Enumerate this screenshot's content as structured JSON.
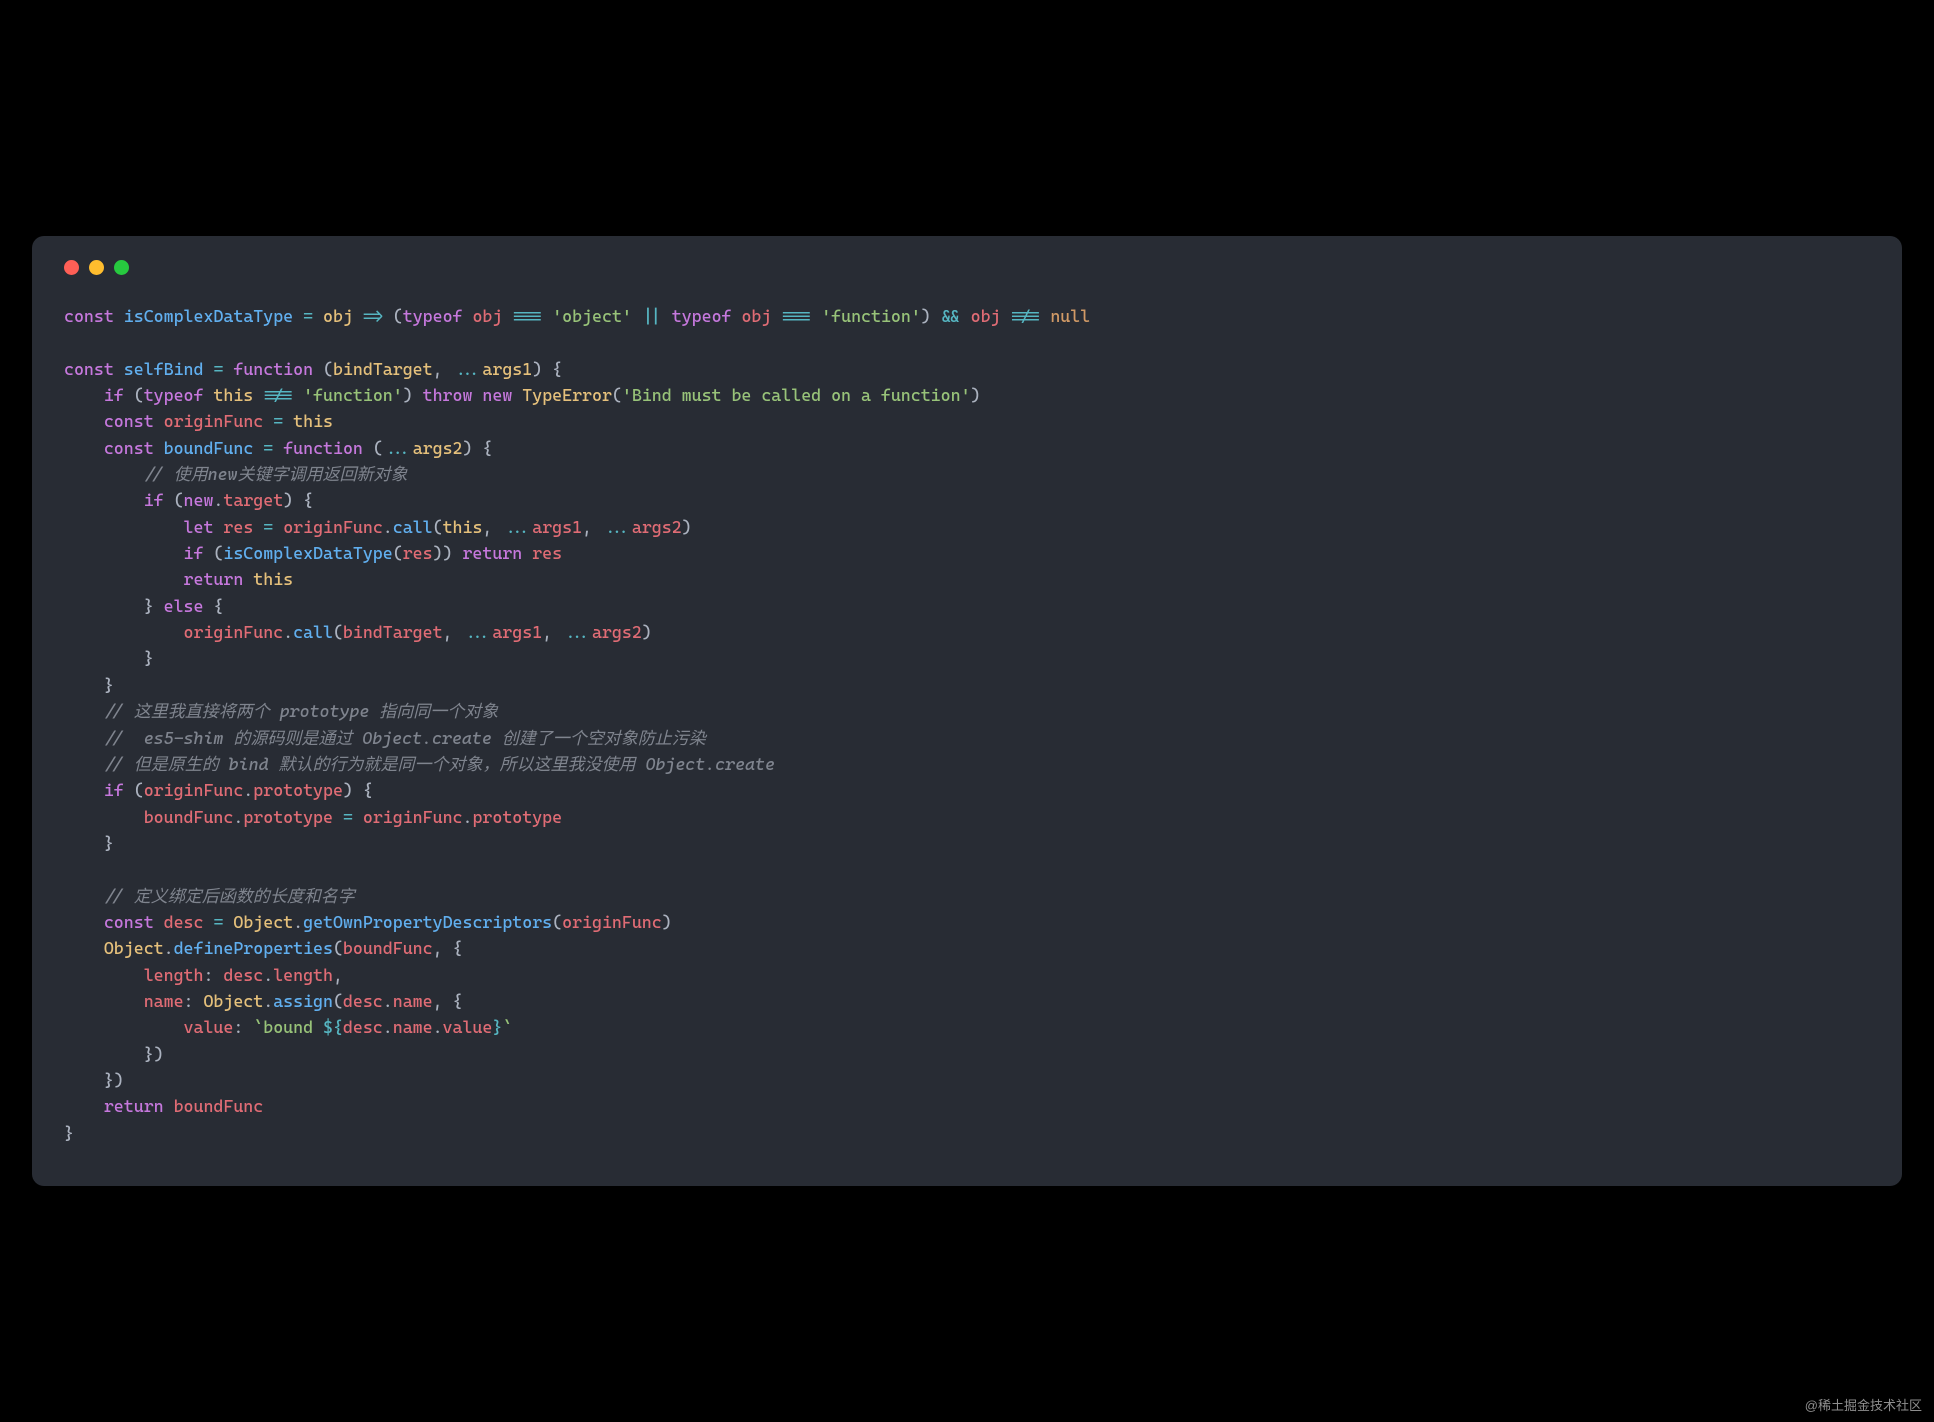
{
  "watermark": "@稀土掘金技术社区",
  "code": {
    "lines": [
      {
        "segments": [
          {
            "cls": "kw",
            "t": "const"
          },
          {
            "cls": "punc",
            "t": " "
          },
          {
            "cls": "fn",
            "t": "isComplexDataType"
          },
          {
            "cls": "punc",
            "t": " "
          },
          {
            "cls": "op",
            "t": "="
          },
          {
            "cls": "punc",
            "t": " "
          },
          {
            "cls": "param",
            "t": "obj"
          },
          {
            "cls": "punc",
            "t": " "
          },
          {
            "cls": "op",
            "t": "=>"
          },
          {
            "cls": "punc",
            "t": " ("
          },
          {
            "cls": "kw",
            "t": "typeof"
          },
          {
            "cls": "punc",
            "t": " "
          },
          {
            "cls": "var",
            "t": "obj"
          },
          {
            "cls": "punc",
            "t": " "
          },
          {
            "cls": "op",
            "t": "==="
          },
          {
            "cls": "punc",
            "t": " "
          },
          {
            "cls": "str",
            "t": "'object'"
          },
          {
            "cls": "punc",
            "t": " "
          },
          {
            "cls": "op",
            "t": "||"
          },
          {
            "cls": "punc",
            "t": " "
          },
          {
            "cls": "kw",
            "t": "typeof"
          },
          {
            "cls": "punc",
            "t": " "
          },
          {
            "cls": "var",
            "t": "obj"
          },
          {
            "cls": "punc",
            "t": " "
          },
          {
            "cls": "op",
            "t": "==="
          },
          {
            "cls": "punc",
            "t": " "
          },
          {
            "cls": "str",
            "t": "'function'"
          },
          {
            "cls": "punc",
            "t": ") "
          },
          {
            "cls": "op",
            "t": "&&"
          },
          {
            "cls": "punc",
            "t": " "
          },
          {
            "cls": "var",
            "t": "obj"
          },
          {
            "cls": "punc",
            "t": " "
          },
          {
            "cls": "op",
            "t": "!=="
          },
          {
            "cls": "punc",
            "t": " "
          },
          {
            "cls": "num",
            "t": "null"
          }
        ]
      },
      {
        "segments": []
      },
      {
        "segments": [
          {
            "cls": "kw",
            "t": "const"
          },
          {
            "cls": "punc",
            "t": " "
          },
          {
            "cls": "fn",
            "t": "selfBind"
          },
          {
            "cls": "punc",
            "t": " "
          },
          {
            "cls": "op",
            "t": "="
          },
          {
            "cls": "punc",
            "t": " "
          },
          {
            "cls": "kw",
            "t": "function"
          },
          {
            "cls": "punc",
            "t": " ("
          },
          {
            "cls": "param",
            "t": "bindTarget"
          },
          {
            "cls": "punc",
            "t": ", "
          },
          {
            "cls": "op",
            "t": "..."
          },
          {
            "cls": "param",
            "t": "args1"
          },
          {
            "cls": "punc",
            "t": ") {"
          }
        ]
      },
      {
        "segments": [
          {
            "cls": "punc",
            "t": "    "
          },
          {
            "cls": "kw",
            "t": "if"
          },
          {
            "cls": "punc",
            "t": " ("
          },
          {
            "cls": "kw",
            "t": "typeof"
          },
          {
            "cls": "punc",
            "t": " "
          },
          {
            "cls": "this",
            "t": "this"
          },
          {
            "cls": "punc",
            "t": " "
          },
          {
            "cls": "op",
            "t": "!=="
          },
          {
            "cls": "punc",
            "t": " "
          },
          {
            "cls": "str",
            "t": "'function'"
          },
          {
            "cls": "punc",
            "t": ") "
          },
          {
            "cls": "kw",
            "t": "throw"
          },
          {
            "cls": "punc",
            "t": " "
          },
          {
            "cls": "kw",
            "t": "new"
          },
          {
            "cls": "punc",
            "t": " "
          },
          {
            "cls": "builtin",
            "t": "TypeError"
          },
          {
            "cls": "punc",
            "t": "("
          },
          {
            "cls": "str",
            "t": "'Bind must be called on a function'"
          },
          {
            "cls": "punc",
            "t": ")"
          }
        ]
      },
      {
        "segments": [
          {
            "cls": "punc",
            "t": "    "
          },
          {
            "cls": "kw",
            "t": "const"
          },
          {
            "cls": "punc",
            "t": " "
          },
          {
            "cls": "var",
            "t": "originFunc"
          },
          {
            "cls": "punc",
            "t": " "
          },
          {
            "cls": "op",
            "t": "="
          },
          {
            "cls": "punc",
            "t": " "
          },
          {
            "cls": "this",
            "t": "this"
          }
        ]
      },
      {
        "segments": [
          {
            "cls": "punc",
            "t": "    "
          },
          {
            "cls": "kw",
            "t": "const"
          },
          {
            "cls": "punc",
            "t": " "
          },
          {
            "cls": "fn",
            "t": "boundFunc"
          },
          {
            "cls": "punc",
            "t": " "
          },
          {
            "cls": "op",
            "t": "="
          },
          {
            "cls": "punc",
            "t": " "
          },
          {
            "cls": "kw",
            "t": "function"
          },
          {
            "cls": "punc",
            "t": " ("
          },
          {
            "cls": "op",
            "t": "..."
          },
          {
            "cls": "param",
            "t": "args2"
          },
          {
            "cls": "punc",
            "t": ") {"
          }
        ]
      },
      {
        "segments": [
          {
            "cls": "punc",
            "t": "        "
          },
          {
            "cls": "com",
            "t": "// 使用new关键字调用返回新对象"
          }
        ]
      },
      {
        "segments": [
          {
            "cls": "punc",
            "t": "        "
          },
          {
            "cls": "kw",
            "t": "if"
          },
          {
            "cls": "punc",
            "t": " ("
          },
          {
            "cls": "kw",
            "t": "new"
          },
          {
            "cls": "punc",
            "t": "."
          },
          {
            "cls": "prop",
            "t": "target"
          },
          {
            "cls": "punc",
            "t": ") {"
          }
        ]
      },
      {
        "segments": [
          {
            "cls": "punc",
            "t": "            "
          },
          {
            "cls": "kw",
            "t": "let"
          },
          {
            "cls": "punc",
            "t": " "
          },
          {
            "cls": "var",
            "t": "res"
          },
          {
            "cls": "punc",
            "t": " "
          },
          {
            "cls": "op",
            "t": "="
          },
          {
            "cls": "punc",
            "t": " "
          },
          {
            "cls": "var",
            "t": "originFunc"
          },
          {
            "cls": "punc",
            "t": "."
          },
          {
            "cls": "fn",
            "t": "call"
          },
          {
            "cls": "punc",
            "t": "("
          },
          {
            "cls": "this",
            "t": "this"
          },
          {
            "cls": "punc",
            "t": ", "
          },
          {
            "cls": "op",
            "t": "..."
          },
          {
            "cls": "var",
            "t": "args1"
          },
          {
            "cls": "punc",
            "t": ", "
          },
          {
            "cls": "op",
            "t": "..."
          },
          {
            "cls": "var",
            "t": "args2"
          },
          {
            "cls": "punc",
            "t": ")"
          }
        ]
      },
      {
        "segments": [
          {
            "cls": "punc",
            "t": "            "
          },
          {
            "cls": "kw",
            "t": "if"
          },
          {
            "cls": "punc",
            "t": " ("
          },
          {
            "cls": "fn",
            "t": "isComplexDataType"
          },
          {
            "cls": "punc",
            "t": "("
          },
          {
            "cls": "var",
            "t": "res"
          },
          {
            "cls": "punc",
            "t": ")) "
          },
          {
            "cls": "kw",
            "t": "return"
          },
          {
            "cls": "punc",
            "t": " "
          },
          {
            "cls": "var",
            "t": "res"
          }
        ]
      },
      {
        "segments": [
          {
            "cls": "punc",
            "t": "            "
          },
          {
            "cls": "kw",
            "t": "return"
          },
          {
            "cls": "punc",
            "t": " "
          },
          {
            "cls": "this",
            "t": "this"
          }
        ]
      },
      {
        "segments": [
          {
            "cls": "punc",
            "t": "        } "
          },
          {
            "cls": "kw",
            "t": "else"
          },
          {
            "cls": "punc",
            "t": " {"
          }
        ]
      },
      {
        "segments": [
          {
            "cls": "punc",
            "t": "            "
          },
          {
            "cls": "var",
            "t": "originFunc"
          },
          {
            "cls": "punc",
            "t": "."
          },
          {
            "cls": "fn",
            "t": "call"
          },
          {
            "cls": "punc",
            "t": "("
          },
          {
            "cls": "var",
            "t": "bindTarget"
          },
          {
            "cls": "punc",
            "t": ", "
          },
          {
            "cls": "op",
            "t": "..."
          },
          {
            "cls": "var",
            "t": "args1"
          },
          {
            "cls": "punc",
            "t": ", "
          },
          {
            "cls": "op",
            "t": "..."
          },
          {
            "cls": "var",
            "t": "args2"
          },
          {
            "cls": "punc",
            "t": ")"
          }
        ]
      },
      {
        "segments": [
          {
            "cls": "punc",
            "t": "        }"
          }
        ]
      },
      {
        "segments": [
          {
            "cls": "punc",
            "t": "    }"
          }
        ]
      },
      {
        "segments": [
          {
            "cls": "punc",
            "t": "    "
          },
          {
            "cls": "com",
            "t": "// 这里我直接将两个 prototype 指向同一个对象"
          }
        ]
      },
      {
        "segments": [
          {
            "cls": "punc",
            "t": "    "
          },
          {
            "cls": "com",
            "t": "//  es5-shim 的源码则是通过 Object.create 创建了一个空对象防止污染"
          }
        ]
      },
      {
        "segments": [
          {
            "cls": "punc",
            "t": "    "
          },
          {
            "cls": "com",
            "t": "// 但是原生的 bind 默认的行为就是同一个对象，所以这里我没使用 Object.create"
          }
        ]
      },
      {
        "segments": [
          {
            "cls": "punc",
            "t": "    "
          },
          {
            "cls": "kw",
            "t": "if"
          },
          {
            "cls": "punc",
            "t": " ("
          },
          {
            "cls": "var",
            "t": "originFunc"
          },
          {
            "cls": "punc",
            "t": "."
          },
          {
            "cls": "prop",
            "t": "prototype"
          },
          {
            "cls": "punc",
            "t": ") {"
          }
        ]
      },
      {
        "segments": [
          {
            "cls": "punc",
            "t": "        "
          },
          {
            "cls": "var",
            "t": "boundFunc"
          },
          {
            "cls": "punc",
            "t": "."
          },
          {
            "cls": "prop",
            "t": "prototype"
          },
          {
            "cls": "punc",
            "t": " "
          },
          {
            "cls": "op",
            "t": "="
          },
          {
            "cls": "punc",
            "t": " "
          },
          {
            "cls": "var",
            "t": "originFunc"
          },
          {
            "cls": "punc",
            "t": "."
          },
          {
            "cls": "prop",
            "t": "prototype"
          }
        ]
      },
      {
        "segments": [
          {
            "cls": "punc",
            "t": "    }"
          }
        ]
      },
      {
        "segments": []
      },
      {
        "segments": [
          {
            "cls": "punc",
            "t": "    "
          },
          {
            "cls": "com",
            "t": "// 定义绑定后函数的长度和名字"
          }
        ]
      },
      {
        "segments": [
          {
            "cls": "punc",
            "t": "    "
          },
          {
            "cls": "kw",
            "t": "const"
          },
          {
            "cls": "punc",
            "t": " "
          },
          {
            "cls": "var",
            "t": "desc"
          },
          {
            "cls": "punc",
            "t": " "
          },
          {
            "cls": "op",
            "t": "="
          },
          {
            "cls": "punc",
            "t": " "
          },
          {
            "cls": "builtin",
            "t": "Object"
          },
          {
            "cls": "punc",
            "t": "."
          },
          {
            "cls": "fn",
            "t": "getOwnPropertyDescriptors"
          },
          {
            "cls": "punc",
            "t": "("
          },
          {
            "cls": "var",
            "t": "originFunc"
          },
          {
            "cls": "punc",
            "t": ")"
          }
        ]
      },
      {
        "segments": [
          {
            "cls": "punc",
            "t": "    "
          },
          {
            "cls": "builtin",
            "t": "Object"
          },
          {
            "cls": "punc",
            "t": "."
          },
          {
            "cls": "fn",
            "t": "defineProperties"
          },
          {
            "cls": "punc",
            "t": "("
          },
          {
            "cls": "var",
            "t": "boundFunc"
          },
          {
            "cls": "punc",
            "t": ", {"
          }
        ]
      },
      {
        "segments": [
          {
            "cls": "punc",
            "t": "        "
          },
          {
            "cls": "prop",
            "t": "length"
          },
          {
            "cls": "punc",
            "t": ": "
          },
          {
            "cls": "var",
            "t": "desc"
          },
          {
            "cls": "punc",
            "t": "."
          },
          {
            "cls": "prop",
            "t": "length"
          },
          {
            "cls": "punc",
            "t": ","
          }
        ]
      },
      {
        "segments": [
          {
            "cls": "punc",
            "t": "        "
          },
          {
            "cls": "prop",
            "t": "name"
          },
          {
            "cls": "punc",
            "t": ": "
          },
          {
            "cls": "builtin",
            "t": "Object"
          },
          {
            "cls": "punc",
            "t": "."
          },
          {
            "cls": "fn",
            "t": "assign"
          },
          {
            "cls": "punc",
            "t": "("
          },
          {
            "cls": "var",
            "t": "desc"
          },
          {
            "cls": "punc",
            "t": "."
          },
          {
            "cls": "prop",
            "t": "name"
          },
          {
            "cls": "punc",
            "t": ", {"
          }
        ]
      },
      {
        "segments": [
          {
            "cls": "punc",
            "t": "            "
          },
          {
            "cls": "prop",
            "t": "value"
          },
          {
            "cls": "punc",
            "t": ": "
          },
          {
            "cls": "str",
            "t": "`bound "
          },
          {
            "cls": "op",
            "t": "${"
          },
          {
            "cls": "var",
            "t": "desc"
          },
          {
            "cls": "punc",
            "t": "."
          },
          {
            "cls": "prop",
            "t": "name"
          },
          {
            "cls": "punc",
            "t": "."
          },
          {
            "cls": "prop",
            "t": "value"
          },
          {
            "cls": "op",
            "t": "}"
          },
          {
            "cls": "str",
            "t": "`"
          }
        ]
      },
      {
        "segments": [
          {
            "cls": "punc",
            "t": "        })"
          }
        ]
      },
      {
        "segments": [
          {
            "cls": "punc",
            "t": "    })"
          }
        ]
      },
      {
        "segments": [
          {
            "cls": "punc",
            "t": "    "
          },
          {
            "cls": "kw",
            "t": "return"
          },
          {
            "cls": "punc",
            "t": " "
          },
          {
            "cls": "var",
            "t": "boundFunc"
          }
        ]
      },
      {
        "segments": [
          {
            "cls": "punc",
            "t": "}"
          }
        ]
      }
    ]
  }
}
